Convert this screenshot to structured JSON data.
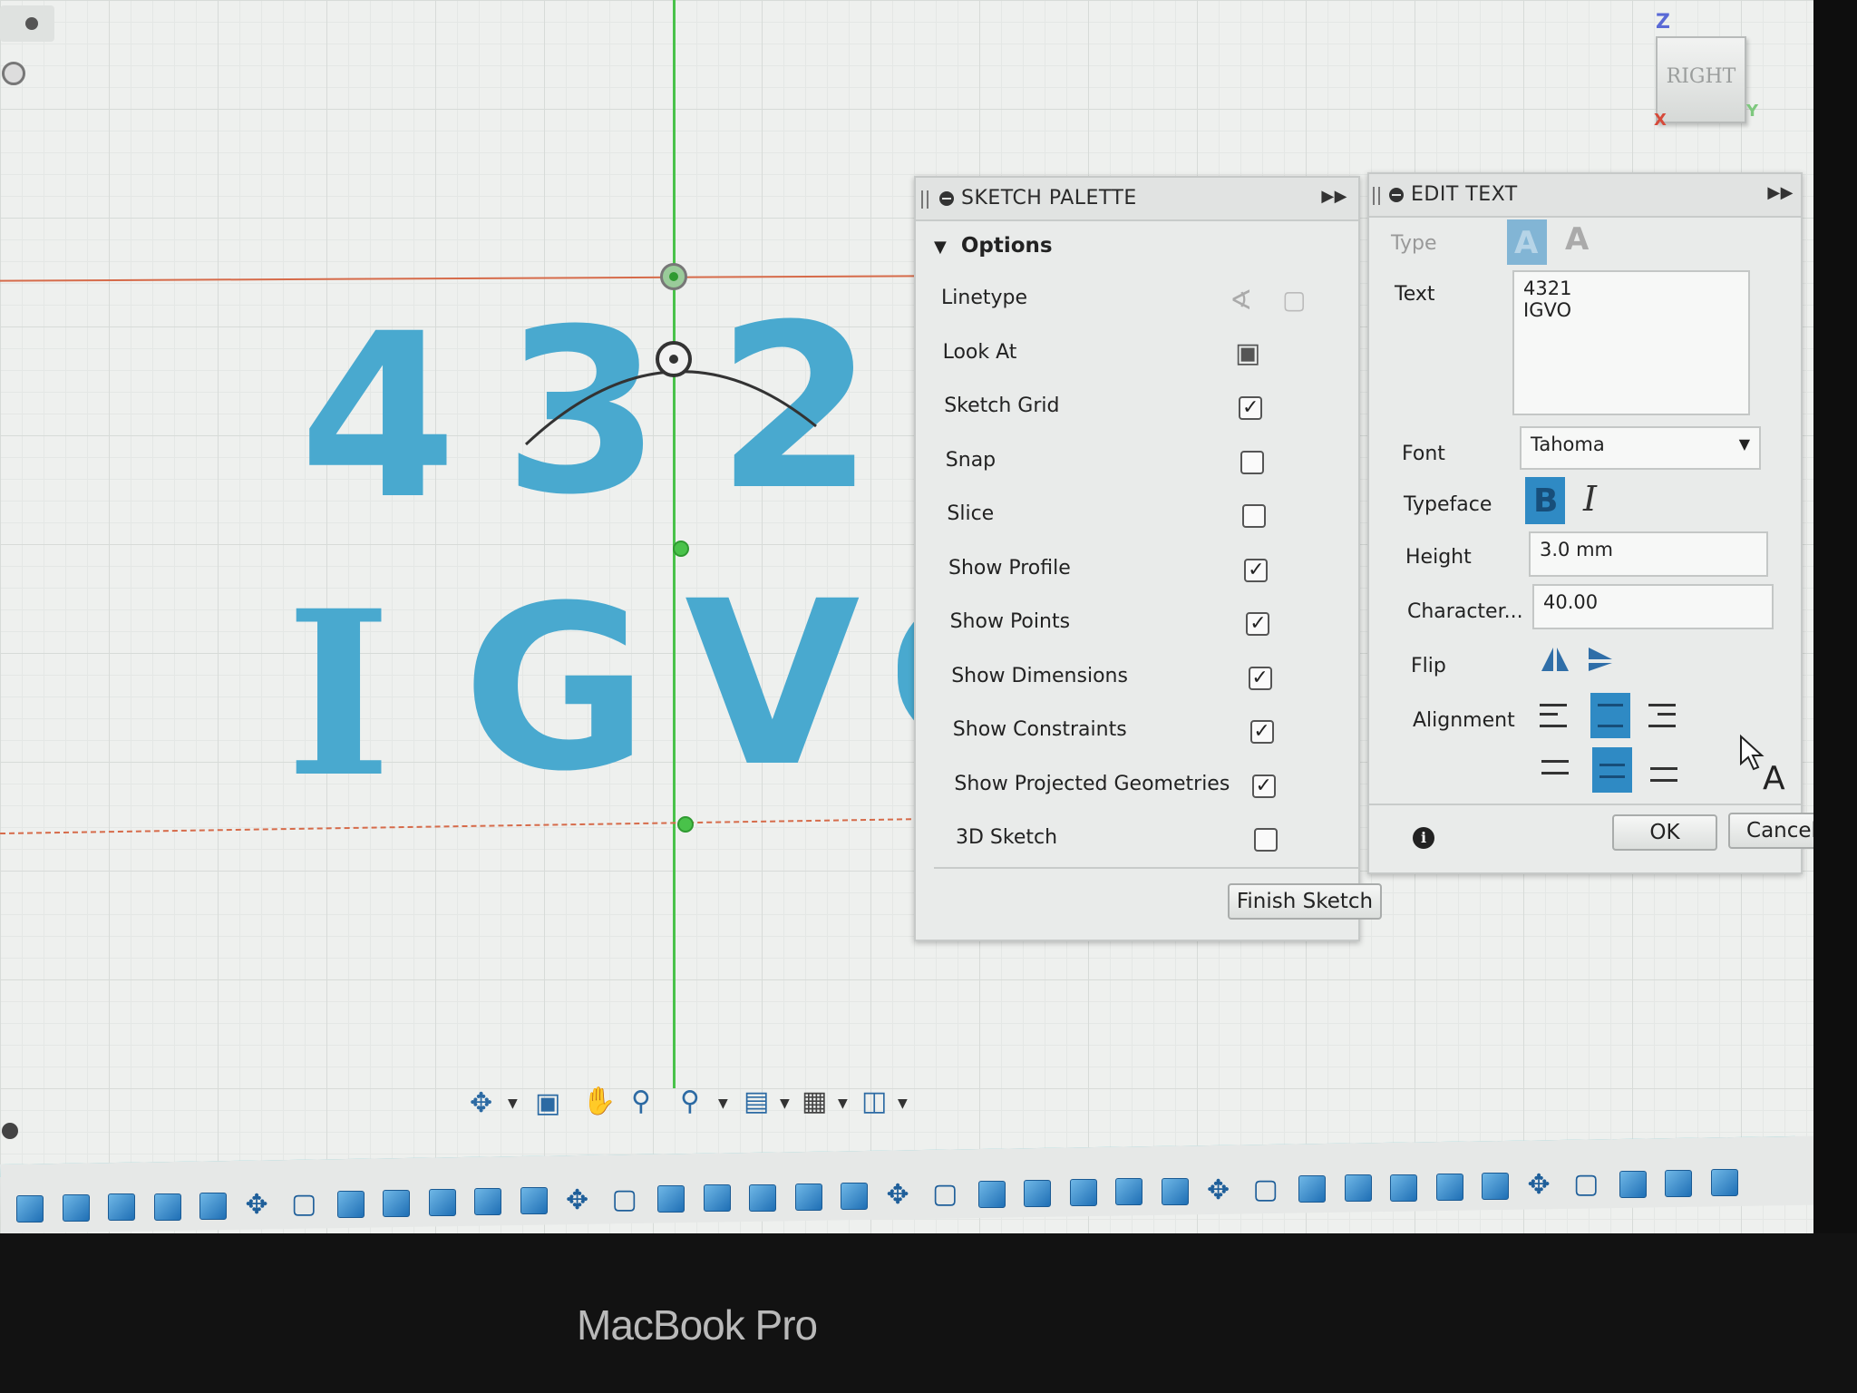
{
  "viewcube": {
    "face_label": "RIGHT",
    "axis_z": "Z",
    "axis_x": "X",
    "axis_y": "Y"
  },
  "canvas": {
    "sketch_text_line1": [
      "4",
      "3",
      "2"
    ],
    "sketch_text_line2": [
      "I",
      "G",
      "V"
    ]
  },
  "sketch_palette": {
    "title": "SKETCH PALETTE",
    "section": "Options",
    "options": [
      {
        "label": "Linetype",
        "control": "linetype"
      },
      {
        "label": "Look At",
        "control": "look-at"
      },
      {
        "label": "Sketch Grid",
        "control": "checkbox",
        "checked": true
      },
      {
        "label": "Snap",
        "control": "checkbox",
        "checked": false
      },
      {
        "label": "Slice",
        "control": "checkbox",
        "checked": false
      },
      {
        "label": "Show Profile",
        "control": "checkbox",
        "checked": true
      },
      {
        "label": "Show Points",
        "control": "checkbox",
        "checked": true
      },
      {
        "label": "Show Dimensions",
        "control": "checkbox",
        "checked": true
      },
      {
        "label": "Show Constraints",
        "control": "checkbox",
        "checked": true
      },
      {
        "label": "Show Projected Geometries",
        "control": "checkbox",
        "checked": true
      },
      {
        "label": "3D Sketch",
        "control": "checkbox",
        "checked": false
      }
    ],
    "finish_button": "Finish Sketch"
  },
  "edit_text": {
    "title": "EDIT TEXT",
    "type_label": "Type",
    "text_label": "Text",
    "text_value": "4321\nIGVO",
    "font_label": "Font",
    "font_value": "Tahoma",
    "typeface_label": "Typeface",
    "bold_glyph": "B",
    "italic_glyph": "I",
    "height_label": "Height",
    "height_value": "3.0 mm",
    "char_label": "Character...",
    "char_value": "40.00",
    "flip_label": "Flip",
    "alignment_label": "Alignment",
    "type_glyph": "A",
    "ok_button": "OK",
    "cancel_button": "Cancel",
    "info_glyph": "i"
  },
  "bezel": {
    "brand": "MacBook Pro"
  },
  "colors": {
    "text_blue": "#49a9cf",
    "selected_blue": "#2f8ac4",
    "axis_green": "#49c24a",
    "axis_red": "#d66b4a",
    "timeline_teal": "#3cc0c9"
  }
}
